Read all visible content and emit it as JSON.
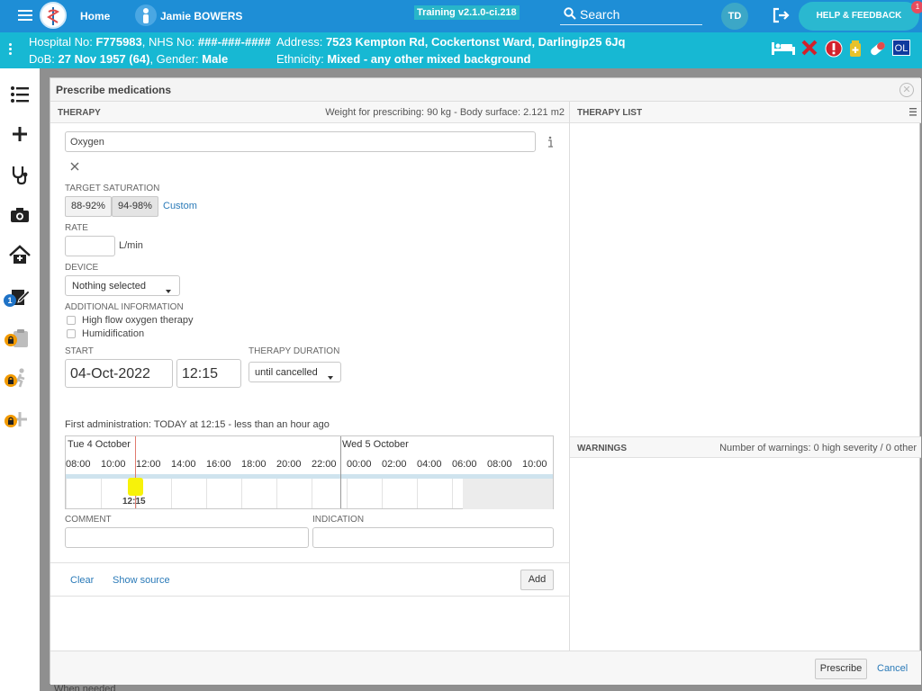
{
  "topbar": {
    "home_label": "Home",
    "patient_name": "Jamie BOWERS",
    "training_label": "Training v2.1.0-ci.218",
    "search_label": "Search",
    "avatar_initials": "TD",
    "help_label": "HELP & FEEDBACK",
    "help_badge": "1"
  },
  "banner": {
    "hospital_label": "Hospital No:",
    "hospital_no": "F775983",
    "nhs_label": "NHS No:",
    "nhs_no": "###-###-####",
    "address_label": "Address:",
    "address": "7523 Kempton Rd, Cockertonst Ward, Darlingip25 6Jq",
    "dob_label": "DoB:",
    "dob": "27 Nov 1957 (64)",
    "gender_label": "Gender:",
    "gender": "Male",
    "ethnicity_label": "Ethnicity:",
    "ethnicity": "Mixed - any other mixed background",
    "ol_label": "OL"
  },
  "sidebar": {
    "badge_count": "1"
  },
  "background": {
    "footer_text": "When needed"
  },
  "modal": {
    "title": "Prescribe medications",
    "therapy_header": "THERAPY",
    "weight_info": "Weight for prescribing: 90 kg - Body surface: 2.121 m2",
    "therapy_list_header": "THERAPY LIST",
    "warnings_header": "WARNINGS",
    "warnings_info": "Number of warnings: 0 high severity / 0 other",
    "medication_value": "Oxygen",
    "target_saturation_label": "TARGET SATURATION",
    "sat_option_1": "88-92%",
    "sat_option_2": "94-98%",
    "sat_custom": "Custom",
    "rate_label": "RATE",
    "rate_value": "",
    "rate_unit": "L/min",
    "device_label": "DEVICE",
    "device_value": "Nothing selected",
    "additional_label": "ADDITIONAL INFORMATION",
    "high_flow_label": "High flow oxygen therapy",
    "humidification_label": "Humidification",
    "start_label": "START",
    "start_date": "04-Oct-2022",
    "start_time": "12:15",
    "duration_label": "THERAPY DURATION",
    "duration_value": "until cancelled",
    "first_admin": "First administration: TODAY at 12:15 - less than an hour ago",
    "timeline": {
      "day1": "Tue 4 October",
      "day2": "Wed 5 October",
      "hours": [
        "08:00",
        "10:00",
        "12:00",
        "14:00",
        "16:00",
        "18:00",
        "20:00",
        "22:00",
        "00:00",
        "02:00",
        "04:00",
        "06:00",
        "08:00",
        "10:00"
      ],
      "marker_label": "12:15"
    },
    "comment_label": "COMMENT",
    "indication_label": "INDICATION",
    "clear_label": "Clear",
    "show_source_label": "Show source",
    "add_label": "Add",
    "prescribe_label": "Prescribe",
    "cancel_label": "Cancel"
  }
}
